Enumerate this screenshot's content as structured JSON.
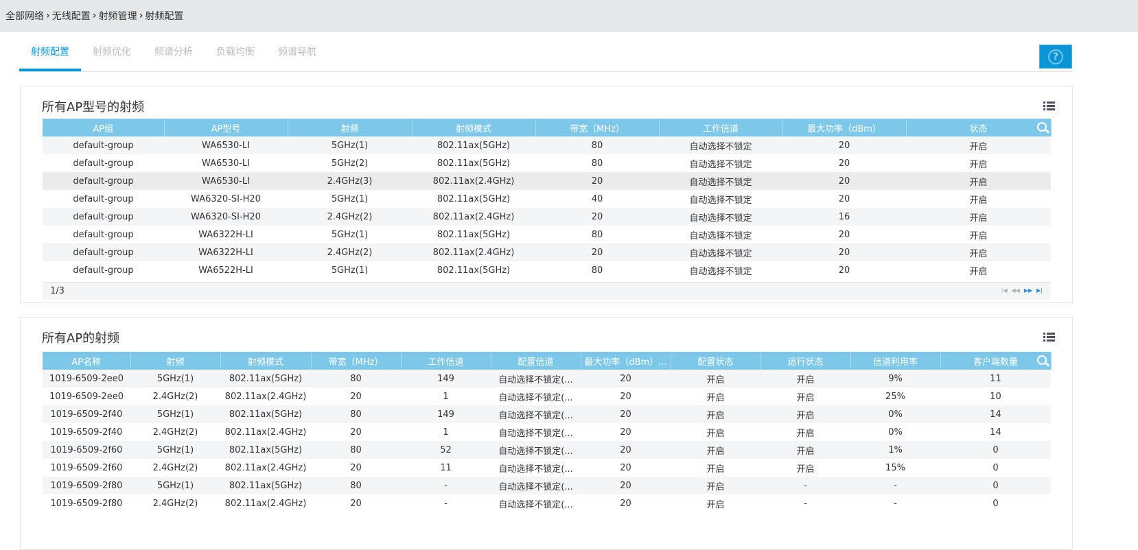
{
  "breadcrumb": [
    "全部网络",
    "无线配置",
    "射频管理",
    "射频配置"
  ],
  "tabs": [
    "射频配置",
    "射频优化",
    "频谱分析",
    "负载均衡",
    "频谱导航"
  ],
  "help_label": "?",
  "table1": {
    "title": "所有AP型号的射频",
    "columns": [
      "AP组",
      "AP型号",
      "射频",
      "射频模式",
      "带宽（MHz）",
      "工作信道",
      "最大功率（dBm）",
      "状态"
    ],
    "rows": [
      [
        "default-group",
        "WA6530-LI",
        "5GHz(1)",
        "802.11ax(5GHz)",
        "80",
        "自动选择不锁定",
        "20",
        "开启"
      ],
      [
        "default-group",
        "WA6530-LI",
        "5GHz(2)",
        "802.11ax(5GHz)",
        "80",
        "自动选择不锁定",
        "20",
        "开启"
      ],
      [
        "default-group",
        "WA6530-LI",
        "2.4GHz(3)",
        "802.11ax(2.4GHz)",
        "20",
        "自动选择不锁定",
        "20",
        "开启"
      ],
      [
        "default-group",
        "WA6320-SI-H20",
        "5GHz(1)",
        "802.11ax(5GHz)",
        "40",
        "自动选择不锁定",
        "20",
        "开启"
      ],
      [
        "default-group",
        "WA6320-SI-H20",
        "2.4GHz(2)",
        "802.11ax(2.4GHz)",
        "20",
        "自动选择不锁定",
        "16",
        "开启"
      ],
      [
        "default-group",
        "WA6322H-LI",
        "5GHz(1)",
        "802.11ax(5GHz)",
        "80",
        "自动选择不锁定",
        "20",
        "开启"
      ],
      [
        "default-group",
        "WA6322H-LI",
        "2.4GHz(2)",
        "802.11ax(2.4GHz)",
        "20",
        "自动选择不锁定",
        "20",
        "开启"
      ],
      [
        "default-group",
        "WA6522H-LI",
        "5GHz(1)",
        "802.11ax(5GHz)",
        "80",
        "自动选择不锁定",
        "20",
        "开启"
      ]
    ],
    "page": "1/3",
    "pager_buttons": [
      "|◀",
      "◀◀",
      "▶▶",
      "▶|"
    ]
  },
  "table2": {
    "title": "所有AP的射频",
    "columns": [
      "AP名称",
      "射频",
      "射频模式",
      "带宽（MHz）",
      "工作信道",
      "配置信道",
      "最大功率（dBm）...",
      "配置状态",
      "运行状态",
      "信道利用率",
      "客户端数量"
    ],
    "rows": [
      [
        "1019-6509-2ee0",
        "5GHz(1)",
        "802.11ax(5GHz)",
        "80",
        "149",
        "自动选择不锁定(...",
        "20",
        "开启",
        "开启",
        "9%",
        "11"
      ],
      [
        "1019-6509-2ee0",
        "2.4GHz(2)",
        "802.11ax(2.4GHz)",
        "20",
        "1",
        "自动选择不锁定(...",
        "20",
        "开启",
        "开启",
        "25%",
        "10"
      ],
      [
        "1019-6509-2f40",
        "5GHz(1)",
        "802.11ax(5GHz)",
        "80",
        "149",
        "自动选择不锁定(...",
        "20",
        "开启",
        "开启",
        "0%",
        "14"
      ],
      [
        "1019-6509-2f40",
        "2.4GHz(2)",
        "802.11ax(2.4GHz)",
        "20",
        "1",
        "自动选择不锁定(...",
        "20",
        "开启",
        "开启",
        "0%",
        "14"
      ],
      [
        "1019-6509-2f60",
        "5GHz(1)",
        "802.11ax(5GHz)",
        "80",
        "52",
        "自动选择不锁定(...",
        "20",
        "开启",
        "开启",
        "1%",
        "0"
      ],
      [
        "1019-6509-2f60",
        "2.4GHz(2)",
        "802.11ax(2.4GHz)",
        "20",
        "11",
        "自动选择不锁定(...",
        "20",
        "开启",
        "开启",
        "15%",
        "0"
      ],
      [
        "1019-6509-2f80",
        "5GHz(1)",
        "802.11ax(5GHz)",
        "80",
        "-",
        "自动选择不锁定(...",
        "20",
        "开启",
        "-",
        "-",
        "0"
      ],
      [
        "1019-6509-2f80",
        "2.4GHz(2)",
        "802.11ax(2.4GHz)",
        "20",
        "-",
        "自动选择不锁定(...",
        "20",
        "开启",
        "-",
        "-",
        "0"
      ]
    ]
  }
}
